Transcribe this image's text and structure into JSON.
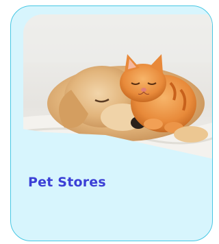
{
  "card": {
    "title": "Pet Stores",
    "image_subject": "puppy-and-kitten-sleeping-image"
  },
  "colors": {
    "card_background": "#d7f5fd",
    "card_border": "#47c7e3",
    "title_color": "#3b3fd6"
  }
}
